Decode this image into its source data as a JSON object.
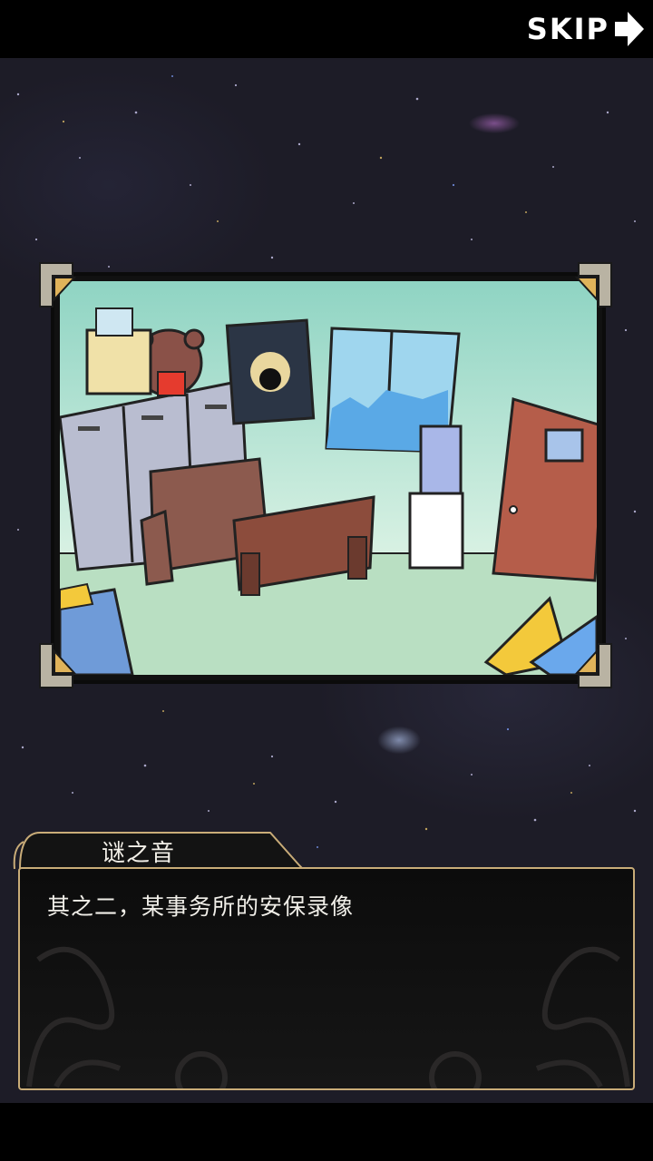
{
  "skip_label": "SKIP",
  "dialog": {
    "speaker": "谜之音",
    "text": "其之二，某事务所的安保录像"
  },
  "icons": {
    "skip": "arrow-right-icon"
  },
  "colors": {
    "frame_gold": "#c9ac78",
    "background": "#1d1c27"
  }
}
